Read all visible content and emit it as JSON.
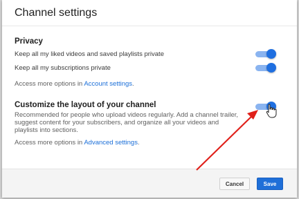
{
  "dialog": {
    "title": "Channel settings"
  },
  "privacy": {
    "heading": "Privacy",
    "rows": [
      {
        "label": "Keep all my liked videos and saved playlists private",
        "enabled": true
      },
      {
        "label": "Keep all my subscriptions private",
        "enabled": true
      }
    ],
    "link_prefix": "Access more options in ",
    "link_text": "Account settings",
    "link_suffix": "."
  },
  "customize": {
    "heading": "Customize the layout of your channel",
    "enabled": true,
    "description": "Recommended for people who upload videos regularly. Add a channel trailer, suggest content for your subscribers, and organize all your videos and playlists into sections.",
    "link_prefix": "Access more options in ",
    "link_text": "Advanced settings",
    "link_suffix": "."
  },
  "footer": {
    "cancel_label": "Cancel",
    "save_label": "Save"
  },
  "colors": {
    "toggle_on": "#1f6fe0",
    "link": "#1a6ed8",
    "save_button": "#1f6fd8",
    "annotation_arrow": "#e0201a"
  },
  "icons": {
    "cursor": "hand-pointer-icon",
    "annotation": "red-arrow-icon"
  }
}
